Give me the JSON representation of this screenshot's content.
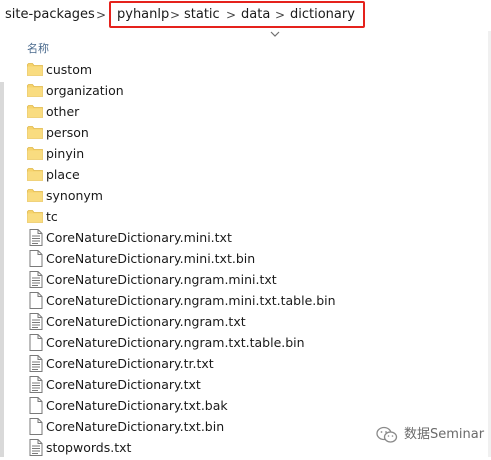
{
  "breadcrumb": {
    "items": [
      "site-packages",
      "pyhanlp",
      "static",
      "data",
      "dictionary"
    ],
    "separator": ">"
  },
  "columns": {
    "name_header": "名称"
  },
  "files": [
    {
      "name": "custom",
      "type": "folder"
    },
    {
      "name": "organization",
      "type": "folder"
    },
    {
      "name": "other",
      "type": "folder"
    },
    {
      "name": "person",
      "type": "folder"
    },
    {
      "name": "pinyin",
      "type": "folder"
    },
    {
      "name": "place",
      "type": "folder"
    },
    {
      "name": "synonym",
      "type": "folder"
    },
    {
      "name": "tc",
      "type": "folder"
    },
    {
      "name": "CoreNatureDictionary.mini.txt",
      "type": "text"
    },
    {
      "name": "CoreNatureDictionary.mini.txt.bin",
      "type": "file"
    },
    {
      "name": "CoreNatureDictionary.ngram.mini.txt",
      "type": "text"
    },
    {
      "name": "CoreNatureDictionary.ngram.mini.txt.table.bin",
      "type": "file"
    },
    {
      "name": "CoreNatureDictionary.ngram.txt",
      "type": "text"
    },
    {
      "name": "CoreNatureDictionary.ngram.txt.table.bin",
      "type": "file"
    },
    {
      "name": "CoreNatureDictionary.tr.txt",
      "type": "text"
    },
    {
      "name": "CoreNatureDictionary.txt",
      "type": "text"
    },
    {
      "name": "CoreNatureDictionary.txt.bak",
      "type": "file"
    },
    {
      "name": "CoreNatureDictionary.txt.bin",
      "type": "file"
    },
    {
      "name": "stopwords.txt",
      "type": "text"
    }
  ],
  "watermark": {
    "text": "数据Seminar",
    "icon": "wechat-icon"
  },
  "colors": {
    "highlight": "#e5221c",
    "folder": "#f6d36c",
    "header": "#4b6b8e"
  }
}
